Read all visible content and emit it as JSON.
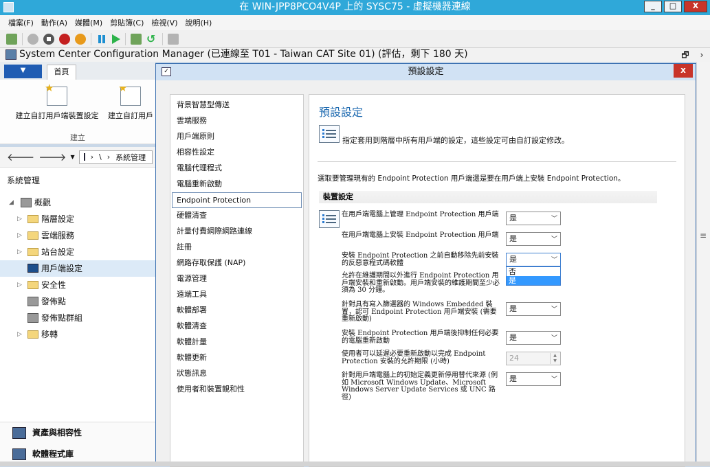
{
  "vm_window": {
    "title": "在 WIN-JPP8PCO4V4P 上的 SYSC75 - 虛擬機器連線",
    "min_label": "_",
    "max_label": "□",
    "close_label": "X"
  },
  "vm_menu": [
    "檔案(F)",
    "動作(A)",
    "媒體(M)",
    "剪貼簿(C)",
    "檢視(V)",
    "說明(H)"
  ],
  "sccm": {
    "title": "System Center Configuration Manager (已連線至 T01 - Taiwan CAT Site 01) (評估，剩下 180 天)",
    "restore_label": "🗗",
    "more_label": "›"
  },
  "ribbon": {
    "home_tab": "首頁",
    "btn1": "建立自訂用戶端裝置設定",
    "btn2": "建立自訂用戶",
    "group": "建立"
  },
  "nav": {
    "back": "🡐",
    "forward": "🡒",
    "crumb_sep": "›",
    "crumb_root": "\\",
    "crumb_item": "系統管理",
    "crumb_more": "›"
  },
  "tree": {
    "workspace": "系統管理",
    "items": [
      {
        "label": "概觀",
        "level": 0
      },
      {
        "label": "階層設定",
        "level": 1
      },
      {
        "label": "雲端服務",
        "level": 1
      },
      {
        "label": "站台設定",
        "level": 1
      },
      {
        "label": "用戶端設定",
        "level": 1
      },
      {
        "label": "安全性",
        "level": 1
      },
      {
        "label": "發佈點",
        "level": 1
      },
      {
        "label": "發佈點群組",
        "level": 1
      },
      {
        "label": "移轉",
        "level": 1
      }
    ]
  },
  "workspaces": [
    "資產與相容性",
    "軟體程式庫"
  ],
  "dialog": {
    "title": "預設設定",
    "nav_items": [
      "背景智慧型傳送",
      "雲端服務",
      "用戶端原則",
      "相容性設定",
      "電腦代理程式",
      "電腦重新啟動",
      "Endpoint Protection",
      "硬體清查",
      "計量付費網際網路連線",
      "註冊",
      "網路存取保護 (NAP)",
      "電源管理",
      "遠端工具",
      "軟體部署",
      "軟體清查",
      "軟體計量",
      "軟體更新",
      "狀態訊息",
      "使用者和裝置親和性"
    ],
    "active_index": 6,
    "heading": "預設設定",
    "description": "指定套用到階層中所有用戶端的設定，這些設定可由自訂設定修改。",
    "intro": "選取要管理現有的 Endpoint Protection 用戶端還是要在用戶端上安裝 Endpoint Protection。",
    "section": "裝置設定",
    "settings": [
      {
        "label": "在用戶端電腦上管理 Endpoint Protection 用戶端",
        "value": "是",
        "type": "select"
      },
      {
        "label": "在用戶端電腦上安裝 Endpoint Protection 用戶端",
        "value": "是",
        "type": "select"
      },
      {
        "label": "安裝 Endpoint Protection 之前自動移除先前安裝的反惡意程式碼軟體",
        "value": "是",
        "type": "select-open"
      },
      {
        "label": "允許在維護期間以外進行 Endpoint Protection 用戶端安裝和重新啟動。用戶端安裝的維護期間至少必須為 30 分鐘。",
        "value": "",
        "type": "none"
      },
      {
        "label": "針對具有寫入篩選器的 Windows Embedded 裝置，認可 Endpoint Protection 用戶端安裝 (需要重新啟動)",
        "value": "是",
        "type": "select"
      },
      {
        "label": "安裝 Endpoint Protection 用戶端後抑制任何必要的電腦重新啟動",
        "value": "是",
        "type": "select"
      },
      {
        "label": "使用者可以延遲必要重新啟動以完成 Endpoint Protection 安裝的允許期限 (小時)",
        "value": "24",
        "type": "spin"
      },
      {
        "label": "針對用戶端電腦上的初始定義更新停用替代來源 (例如 Microsoft Windows Update、Microsoft Windows Server Update Services 或 UNC 路徑)",
        "value": "是",
        "type": "select"
      }
    ],
    "dropdown_options": [
      "否",
      "是"
    ],
    "dropdown_highlight": 1
  }
}
